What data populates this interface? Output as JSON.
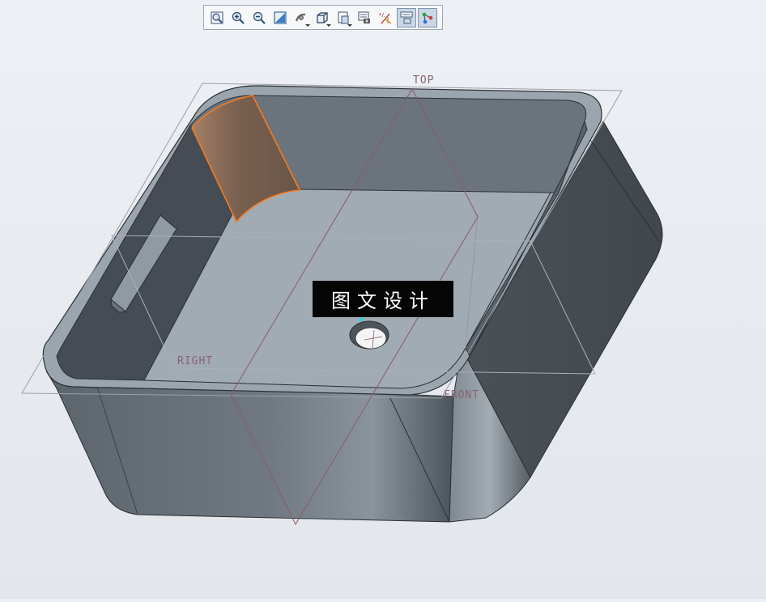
{
  "toolbar": {
    "buttons": [
      {
        "name": "refit-icon",
        "active": false
      },
      {
        "name": "zoom-in-icon",
        "active": false
      },
      {
        "name": "zoom-out-icon",
        "active": false
      },
      {
        "name": "repaint-icon",
        "active": false
      },
      {
        "name": "spin-center-icon",
        "active": false
      },
      {
        "name": "display-style-icon",
        "active": false
      },
      {
        "name": "saved-views-icon",
        "active": false
      },
      {
        "name": "view-manager-icon",
        "active": false
      },
      {
        "name": "datum-display-icon",
        "active": false
      },
      {
        "name": "annotation-display-icon",
        "active": true
      },
      {
        "name": "model-tree-display-icon",
        "active": true
      }
    ]
  },
  "planes": {
    "top": "TOP",
    "right": "RIGHT",
    "front": "FRONT"
  },
  "watermark": {
    "text": "图文设计"
  },
  "colors": {
    "background": "#e8ebf0",
    "model_dark": "#454c53",
    "model_mid": "#6a737c",
    "model_light": "#9ea9b2",
    "highlight_orange": "#ff7a1a",
    "highlight_fill": "#7d6350",
    "datum_plane": "#8a5a66"
  }
}
